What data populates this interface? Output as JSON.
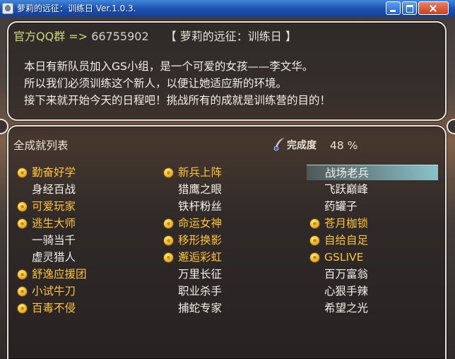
{
  "window": {
    "title": "萝莉的远征：训练日 Ver.1.0.3."
  },
  "header": {
    "qq_label": "官方QQ群 =>",
    "qq_number": "66755902",
    "game_title": "【 萝莉的远征：训练日 】"
  },
  "story": {
    "line1": "本日有新队员加入GS小组，是一个可爱的女孩——李文华。",
    "line2": "所以我们必须训练这个新人，以便让她适应新的环境。",
    "line3": "接下来就开始今天的日程吧！挑战所有的成就是训练营的目的！"
  },
  "achievements_panel": {
    "title": "全成就列表",
    "completion_label": "完成度",
    "completion_value": "48 %",
    "completion_percent": 48
  },
  "achievements": [
    {
      "label": "勤奋好学",
      "earned": true
    },
    {
      "label": "新兵上阵",
      "earned": true
    },
    {
      "label": "战场老兵",
      "earned": false,
      "selected": true
    },
    {
      "label": "身经百战",
      "earned": false
    },
    {
      "label": "猎鹰之眼",
      "earned": false
    },
    {
      "label": "飞跃巅峰",
      "earned": false
    },
    {
      "label": "可爱玩家",
      "earned": true
    },
    {
      "label": "铁杆粉丝",
      "earned": false
    },
    {
      "label": "药罐子",
      "earned": false
    },
    {
      "label": "逃生大师",
      "earned": true
    },
    {
      "label": "命运女神",
      "earned": true
    },
    {
      "label": "苍月枷锁",
      "earned": true
    },
    {
      "label": "一骑当千",
      "earned": false
    },
    {
      "label": "移形换影",
      "earned": true
    },
    {
      "label": "自给自足",
      "earned": true
    },
    {
      "label": "虚灵猎人",
      "earned": false
    },
    {
      "label": "邂逅彩虹",
      "earned": true
    },
    {
      "label": "GSLIVE",
      "earned": true
    },
    {
      "label": "舒逸应援团",
      "earned": true
    },
    {
      "label": "万里长征",
      "earned": false
    },
    {
      "label": "百万富翁",
      "earned": false
    },
    {
      "label": "小试牛刀",
      "earned": true
    },
    {
      "label": "职业杀手",
      "earned": false
    },
    {
      "label": "心狠手辣",
      "earned": false
    },
    {
      "label": "百毒不侵",
      "earned": true
    },
    {
      "label": "捕蛇专家",
      "earned": false
    },
    {
      "label": "希望之光",
      "earned": false
    }
  ],
  "colors": {
    "earned": "#ffc33a",
    "unearned": "#f3f0ea",
    "qq_label": "#c9d97a",
    "titlebar": "#2460c8"
  },
  "icons": {
    "coin": "coin-icon",
    "quill": "quill-icon",
    "app": "app-icon"
  }
}
